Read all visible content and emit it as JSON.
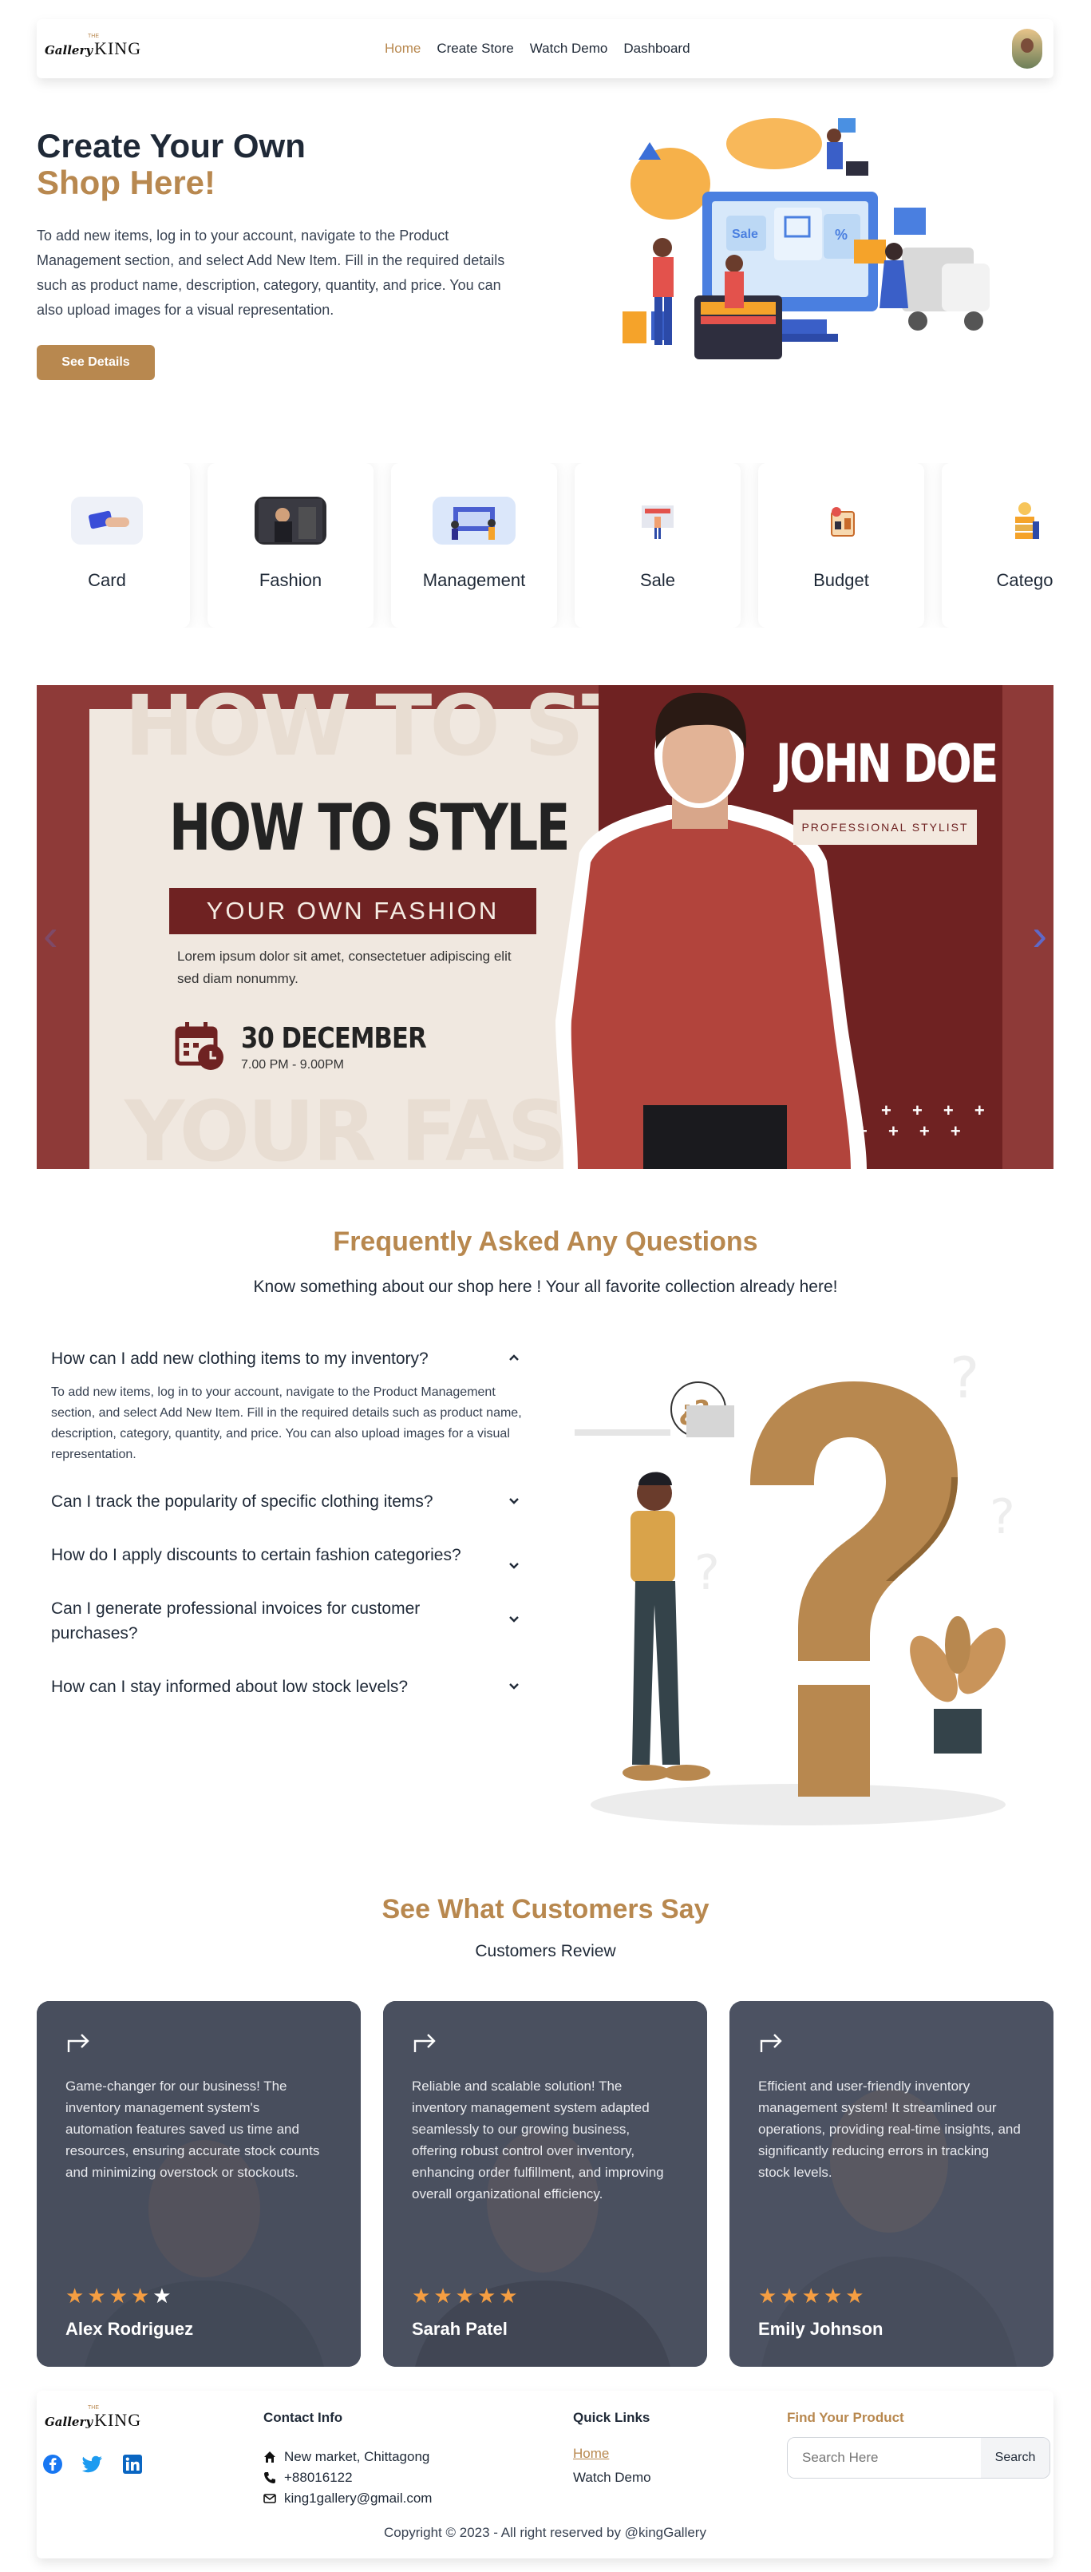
{
  "brand": {
    "logo_script": "Gallery",
    "logo_king": "KING",
    "logo_the": "THE"
  },
  "nav": {
    "links": [
      "Home",
      "Create Store",
      "Watch Demo",
      "Dashboard"
    ],
    "active": "Home"
  },
  "hero": {
    "title_line1": "Create Your Own",
    "title_line2": "Shop Here!",
    "description": "To add new items, log in to your account, navigate to the Product Management section, and select Add New Item. Fill in the required details such as product name, description, category, quantity, and price. You can also upload images for a visual representation.",
    "button": "See Details",
    "illustration_badges": [
      "Sale",
      "%"
    ]
  },
  "categories": [
    "Card",
    "Fashion",
    "Management",
    "Sale",
    "Budget",
    "Catego"
  ],
  "banner": {
    "bg_top": "HOW TO STYLE",
    "bg_bottom": "YOUR FASHION",
    "headline": "HOW TO STYLE",
    "subhead": "YOUR OWN FASHION",
    "body": "Lorem ipsum dolor sit amet, consectetuer adipiscing elit sed diam nonummy.",
    "date": "30 DECEMBER",
    "time": "7.00 PM - 9.00PM",
    "name": "JOHN DOE",
    "role": "PROFESSIONAL STYLIST",
    "decor": "+ + + +",
    "prev_arrow": "‹",
    "next_arrow": "›"
  },
  "faq": {
    "title": "Frequently Asked Any Questions",
    "subtitle": "Know something about our shop here ! Your all favorite collection already here!",
    "items": [
      {
        "q": "How can I add new clothing items to my inventory?",
        "a": "To add new items, log in to your account, navigate to the Product Management section, and select Add New Item. Fill in the required details such as product name, description, category, quantity, and price. You can also upload images for a visual representation.",
        "open": true
      },
      {
        "q": "Can I track the popularity of specific clothing items?",
        "open": false
      },
      {
        "q": "How do I apply discounts to certain fashion categories?",
        "open": false
      },
      {
        "q": "Can I generate professional invoices for customer purchases?",
        "open": false
      },
      {
        "q": "How can I stay informed about low stock levels?",
        "open": false
      }
    ],
    "illustration_bubble": "¿?"
  },
  "reviews": {
    "title": "See What Customers Say",
    "subtitle": "Customers Review",
    "items": [
      {
        "text": "Game-changer for our business! The inventory management system's automation features saved us time and resources, ensuring accurate stock counts and minimizing overstock or stockouts.",
        "name": "Alex Rodriguez",
        "rating": 4.5
      },
      {
        "text": "Reliable and scalable solution! The inventory management system adapted seamlessly to our growing business, offering robust control over inventory, enhancing order fulfillment, and improving overall organizational efficiency.",
        "name": "Sarah Patel",
        "rating": 5
      },
      {
        "text": "Efficient and user-friendly inventory management system! It streamlined our operations, providing real-time insights, and significantly reducing errors in tracking stock levels.",
        "name": "Emily Johnson",
        "rating": 5
      }
    ]
  },
  "footer": {
    "contact_title": "Contact Info",
    "address": "New market, Chittagong",
    "phone": "+88016122",
    "email": "king1gallery@gmail.com",
    "links_title": "Quick Links",
    "links": [
      "Home",
      "Watch Demo"
    ],
    "find_title": "Find Your Product",
    "search_placeholder": "Search Here",
    "search_button": "Search",
    "copyright": "Copyright © 2023 - All right reserved by @kingGallery"
  },
  "colors": {
    "accent": "#b8884f",
    "banner_dark": "#6f2222",
    "banner_side": "#8e3a38",
    "card_overlay": "#4b5160",
    "star": "#f59e42"
  }
}
